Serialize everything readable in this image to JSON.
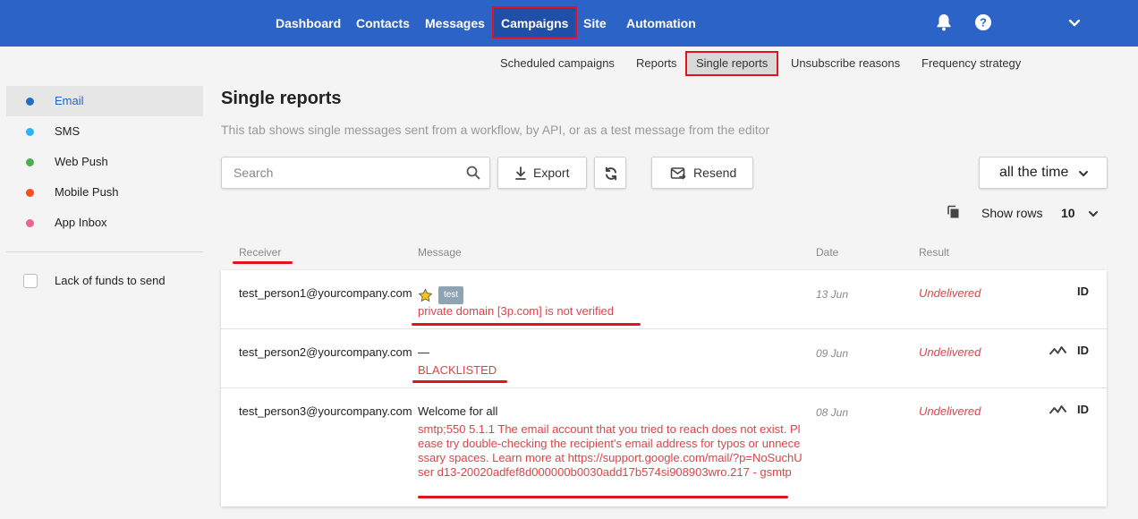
{
  "nav": {
    "items": [
      {
        "label": "Dashboard"
      },
      {
        "label": "Contacts"
      },
      {
        "label": "Messages"
      },
      {
        "label": "Campaigns",
        "active": true
      },
      {
        "label": "Site"
      },
      {
        "label": "Automation"
      }
    ],
    "icons": [
      "bell-icon",
      "help-icon",
      "chevron-down-icon"
    ]
  },
  "subnav": {
    "items": [
      {
        "label": "Scheduled campaigns"
      },
      {
        "label": "Reports"
      },
      {
        "label": "Single reports",
        "active": true
      },
      {
        "label": "Unsubscribe reasons"
      },
      {
        "label": "Frequency strategy"
      }
    ]
  },
  "sidebar": {
    "channels": [
      {
        "label": "Email",
        "color": "#1f6fc4",
        "active": true
      },
      {
        "label": "SMS",
        "color": "#29b6f6"
      },
      {
        "label": "Web Push",
        "color": "#4caf50"
      },
      {
        "label": "Mobile Push",
        "color": "#f4511e"
      },
      {
        "label": "App Inbox",
        "color": "#f06292"
      }
    ],
    "filter_label": "Lack of funds to send"
  },
  "header": {
    "title": "Single reports",
    "description": "This tab shows single messages sent from a workflow, by API, or as a test message from the editor"
  },
  "toolbar": {
    "search_placeholder": "Search",
    "export_label": "Export",
    "resend_label": "Resend",
    "period_label": "all the time",
    "show_rows_label": "Show rows",
    "show_rows_value": "10"
  },
  "table": {
    "headers": {
      "receiver": "Receiver",
      "message": "Message",
      "date": "Date",
      "result": "Result"
    },
    "rows": [
      {
        "receiver": "test_person1@yourcompany.com",
        "message_title": "",
        "tag": "test",
        "starred": true,
        "error": "private domain [3p.com] is not verified",
        "date": "13 Jun",
        "result": "Undelivered",
        "id_label": "ID",
        "has_trend": false
      },
      {
        "receiver": "test_person2@yourcompany.com",
        "message_title": "—",
        "error": "BLACKLISTED",
        "date": "09 Jun",
        "result": "Undelivered",
        "id_label": "ID",
        "has_trend": true
      },
      {
        "receiver": "test_person3@yourcompany.com",
        "message_title": "Welcome for all",
        "error": "smtp;550 5.1.1 The email account that you tried to reach does not exist. Please try double-checking the recipient's email address for typos or unnecessary spaces. Learn more at https://support.google.com/mail/?p=NoSuchUser d13-20020adfef8d000000b0030add17b574si908903wro.217 - gsmtp",
        "date": "08 Jun",
        "result": "Undelivered",
        "id_label": "ID",
        "has_trend": true
      }
    ]
  },
  "colors": {
    "brand": "#2b63c6",
    "highlight": "#e0141e",
    "error_text": "#e0424a"
  }
}
